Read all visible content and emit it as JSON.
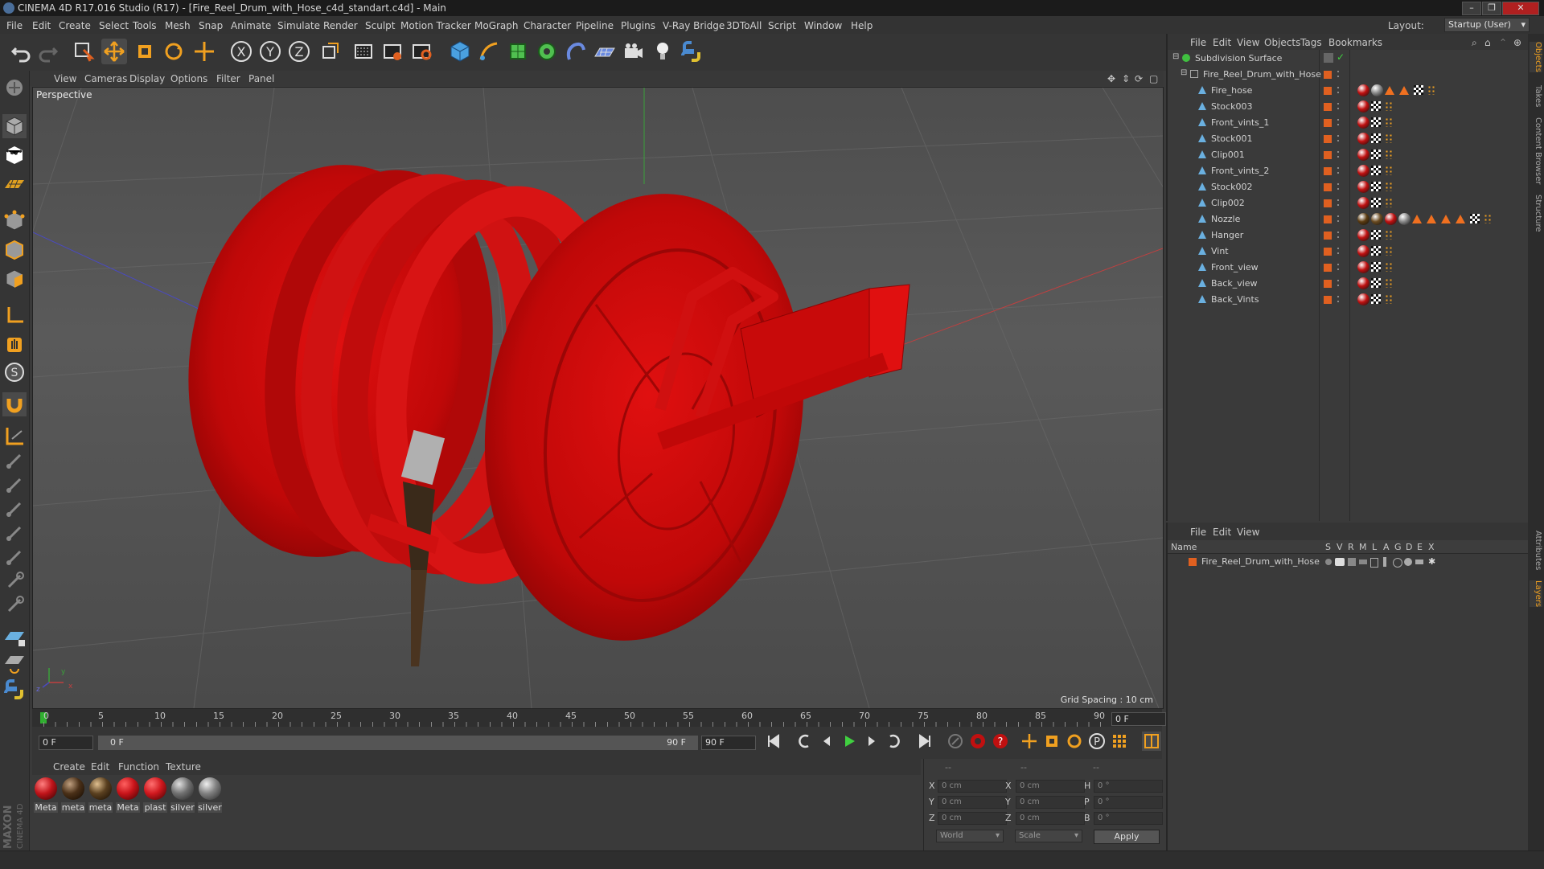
{
  "window": {
    "title": "CINEMA 4D R17.016 Studio (R17) - [Fire_Reel_Drum_with_Hose_c4d_standart.c4d] - Main",
    "minimize": "–",
    "maximize": "❐",
    "close": "✕"
  },
  "menubar": {
    "items": [
      "File",
      "Edit",
      "Create",
      "Select",
      "Tools",
      "Mesh",
      "Snap",
      "Animate",
      "Simulate",
      "Render",
      "Sculpt",
      "Motion Tracker",
      "MoGraph",
      "Character",
      "Pipeline",
      "Plugins",
      "V-Ray Bridge",
      "3DToAll",
      "Script",
      "Window",
      "Help"
    ],
    "layout_label": "Layout:",
    "layout_value": "Startup (User)"
  },
  "toolbar": {
    "icons": [
      "undo-icon",
      "redo-icon",
      "live-selection-icon",
      "move-icon",
      "scale-icon",
      "rotate-icon",
      "transform-icon",
      "x-axis-icon",
      "y-axis-icon",
      "z-axis-icon",
      "coordinate-system-icon",
      "render-view-icon",
      "render-picture-viewer-icon",
      "render-settings-icon",
      "cube-icon",
      "pen-icon",
      "subdivision-icon",
      "array-icon",
      "deformer-icon",
      "floor-icon",
      "camera-icon",
      "light-icon",
      "python-icon"
    ]
  },
  "viewport": {
    "menu": [
      "View",
      "Cameras",
      "Display",
      "Options",
      "Filter",
      "Panel"
    ],
    "label": "Perspective",
    "grid_spacing": "Grid Spacing : 10 cm",
    "axis": {
      "x": "x",
      "y": "y",
      "z": "z"
    }
  },
  "timeline": {
    "ticks": [
      "0",
      "5",
      "10",
      "15",
      "20",
      "25",
      "30",
      "35",
      "40",
      "45",
      "50",
      "55",
      "60",
      "65",
      "70",
      "75",
      "80",
      "85",
      "90"
    ],
    "current_frame": "0 F",
    "start_frame": "0 F",
    "range_start": "0 F",
    "range_end": "90 F",
    "end_frame": "90 F"
  },
  "material_manager": {
    "menu": [
      "Create",
      "Edit",
      "Function",
      "Texture"
    ],
    "materials": [
      {
        "label": "Meta",
        "color": "#c0141a"
      },
      {
        "label": "meta",
        "color": "#4a3018"
      },
      {
        "label": "meta",
        "color": "#5a4020"
      },
      {
        "label": "Meta",
        "color": "#c8141a"
      },
      {
        "label": "plast",
        "color": "#d0181e"
      },
      {
        "label": "silver",
        "color": "#707070"
      },
      {
        "label": "silver",
        "color": "#808080"
      }
    ]
  },
  "coordinates": {
    "header": [
      "--",
      "--",
      "--"
    ],
    "rows": [
      {
        "a": "X",
        "av": "0 cm",
        "b": "X",
        "bv": "0 cm",
        "c": "H",
        "cv": "0 °"
      },
      {
        "a": "Y",
        "av": "0 cm",
        "b": "Y",
        "bv": "0 cm",
        "c": "P",
        "cv": "0 °"
      },
      {
        "a": "Z",
        "av": "0 cm",
        "b": "Z",
        "bv": "0 cm",
        "c": "B",
        "cv": "0 °"
      }
    ],
    "world": "World",
    "scale": "Scale",
    "apply": "Apply"
  },
  "object_manager": {
    "menu": [
      "File",
      "Edit",
      "View",
      "Objects",
      "Tags",
      "Bookmarks"
    ],
    "root": "Subdivision Surface",
    "group": "Fire_Reel_Drum_with_Hose",
    "children": [
      "Fire_hose",
      "Stock003",
      "Front_vints_1",
      "Stock001",
      "Clip001",
      "Front_vints_2",
      "Stock002",
      "Clip002",
      "Nozzle",
      "Hanger",
      "Vint",
      "Front_view",
      "Back_view",
      "Back_Vints"
    ]
  },
  "layer_manager": {
    "menu": [
      "File",
      "Edit",
      "View"
    ],
    "columns": [
      "Name",
      "S",
      "V",
      "R",
      "M",
      "L",
      "A",
      "G",
      "D",
      "E",
      "X"
    ],
    "layer": "Fire_Reel_Drum_with_Hose"
  },
  "right_tabs": [
    "Objects",
    "Takes",
    "Content Browser",
    "Structure",
    "Attributes",
    "Layers"
  ],
  "branding": {
    "maxon": "MAXON",
    "c4d": "CINEMA 4D"
  },
  "colors": {
    "accent_red": "#cc0a0a",
    "accent_orange": "#e06020",
    "background": "#3a3a3a"
  }
}
